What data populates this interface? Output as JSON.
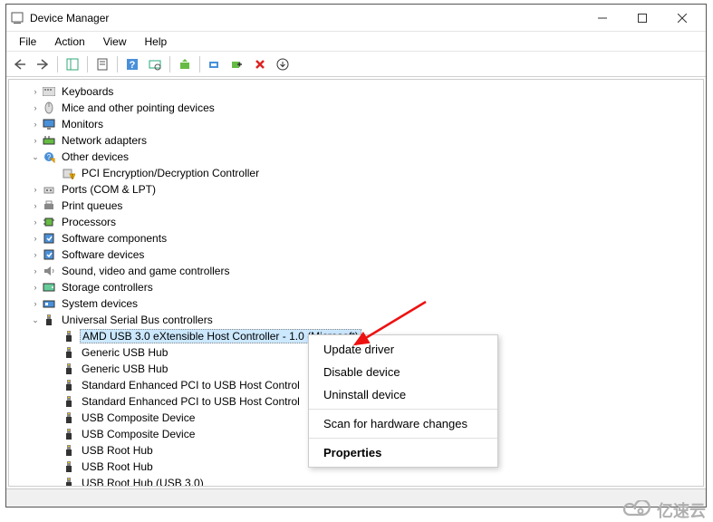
{
  "window": {
    "title": "Device Manager"
  },
  "menubar": [
    "File",
    "Action",
    "View",
    "Help"
  ],
  "context_menu": {
    "items": [
      "Update driver",
      "Disable device",
      "Uninstall device"
    ],
    "after_sep": [
      "Scan for hardware changes"
    ],
    "default": "Properties"
  },
  "tree": {
    "categories": [
      {
        "label": "Keyboards",
        "icon": "keyboard",
        "expanded": false
      },
      {
        "label": "Mice and other pointing devices",
        "icon": "mouse",
        "expanded": false
      },
      {
        "label": "Monitors",
        "icon": "monitor",
        "expanded": false
      },
      {
        "label": "Network adapters",
        "icon": "network",
        "expanded": false
      },
      {
        "label": "Other devices",
        "icon": "warning",
        "expanded": true,
        "children": [
          {
            "label": "PCI Encryption/Decryption Controller",
            "icon": "warning-device"
          }
        ]
      },
      {
        "label": "Ports (COM & LPT)",
        "icon": "port",
        "expanded": false
      },
      {
        "label": "Print queues",
        "icon": "printer",
        "expanded": false
      },
      {
        "label": "Processors",
        "icon": "cpu",
        "expanded": false
      },
      {
        "label": "Software components",
        "icon": "software",
        "expanded": false
      },
      {
        "label": "Software devices",
        "icon": "software",
        "expanded": false
      },
      {
        "label": "Sound, video and game controllers",
        "icon": "audio",
        "expanded": false
      },
      {
        "label": "Storage controllers",
        "icon": "storage",
        "expanded": false
      },
      {
        "label": "System devices",
        "icon": "system",
        "expanded": false
      },
      {
        "label": "Universal Serial Bus controllers",
        "icon": "usb",
        "expanded": true,
        "children": [
          {
            "label": "AMD USB 3.0 eXtensible Host Controller - 1.0 (Microsoft)",
            "icon": "usb",
            "selected": true
          },
          {
            "label": "Generic USB Hub",
            "icon": "usb"
          },
          {
            "label": "Generic USB Hub",
            "icon": "usb"
          },
          {
            "label": "Standard Enhanced PCI to USB Host Control",
            "icon": "usb"
          },
          {
            "label": "Standard Enhanced PCI to USB Host Control",
            "icon": "usb"
          },
          {
            "label": "USB Composite Device",
            "icon": "usb"
          },
          {
            "label": "USB Composite Device",
            "icon": "usb"
          },
          {
            "label": "USB Root Hub",
            "icon": "usb"
          },
          {
            "label": "USB Root Hub",
            "icon": "usb"
          },
          {
            "label": "USB Root Hub (USB 3.0)",
            "icon": "usb"
          }
        ]
      }
    ]
  },
  "watermark": "亿速云"
}
